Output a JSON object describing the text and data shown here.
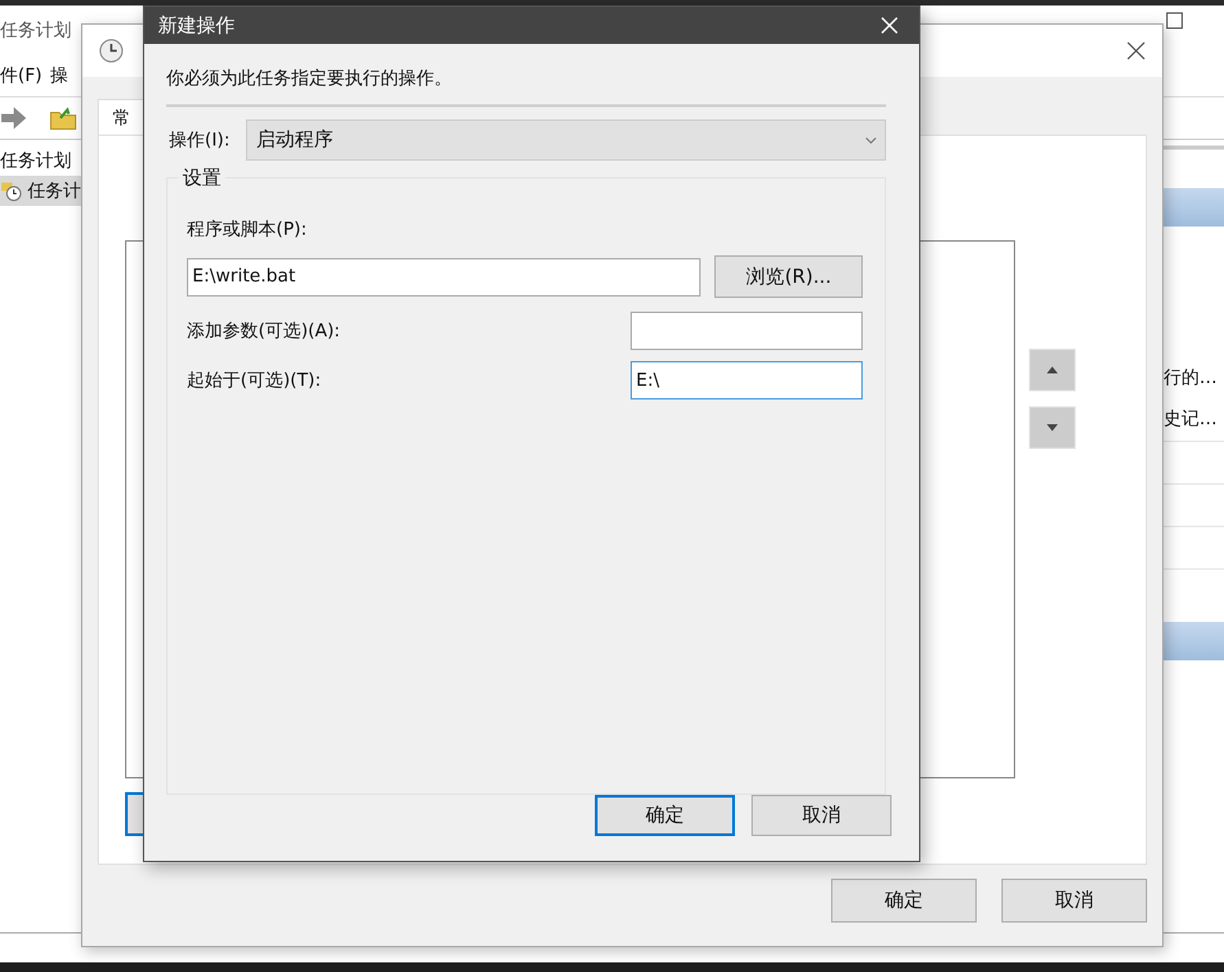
{
  "background_app": {
    "title": "任务计划",
    "menu": [
      {
        "label": "件(F)"
      },
      {
        "label": "操"
      }
    ],
    "tree": [
      {
        "label": "任务计划",
        "selected": false,
        "children": [
          {
            "label": "任务计",
            "selected": true
          }
        ]
      }
    ],
    "actions": [
      {
        "label": "行的…"
      },
      {
        "label": "史记…"
      }
    ]
  },
  "create_task_dialog": {
    "tabs": [
      {
        "label": "常",
        "selected": true
      }
    ],
    "buttons": [
      {
        "label": "确定"
      },
      {
        "label": "取消"
      }
    ]
  },
  "new_action_dialog": {
    "title": "新建操作",
    "instruction": "你必须为此任务指定要执行的操作。",
    "action": {
      "label": "操作(I):",
      "value": "启动程序"
    },
    "settings": {
      "title": "设置",
      "fields": [
        {
          "label": "程序或脚本(P):",
          "value": "E:\\write.bat",
          "focused": false,
          "browse": "浏览(R)..."
        },
        {
          "label": "添加参数(可选)(A):",
          "focused": false
        },
        {
          "label": "起始于(可选)(T):",
          "value": "E:\\",
          "focused": true
        }
      ]
    },
    "buttons": [
      {
        "label": "确定",
        "default": true
      },
      {
        "label": "取消",
        "default": false
      }
    ]
  }
}
